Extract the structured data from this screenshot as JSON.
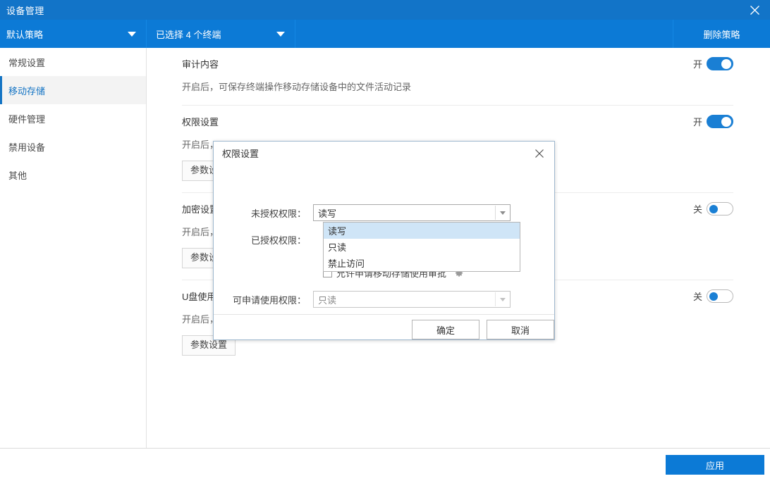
{
  "window": {
    "title": "设备管理",
    "close_icon": "close-icon"
  },
  "toolbar": {
    "policy_select": "默认策略",
    "terminal_select": "已选择 4 个终端",
    "delete_policy": "删除策略"
  },
  "sidebar": {
    "items": [
      {
        "label": "常规设置",
        "selected": false
      },
      {
        "label": "移动存储",
        "selected": true
      },
      {
        "label": "硬件管理",
        "selected": false
      },
      {
        "label": "禁用设备",
        "selected": false
      },
      {
        "label": "其他",
        "selected": false
      }
    ]
  },
  "content": {
    "sections": [
      {
        "title": "审计内容",
        "desc": "开启后，可保存终端操作移动存储设备中的文件活动记录",
        "toggle_label": "开",
        "toggle_state": "on",
        "has_param_button": false,
        "param_button": ""
      },
      {
        "title": "权限设置",
        "desc": "开启后，",
        "toggle_label": "开",
        "toggle_state": "on",
        "has_param_button": true,
        "param_button": "参数设置"
      },
      {
        "title": "加密设置",
        "desc": "开启后，",
        "toggle_label": "关",
        "toggle_state": "off",
        "has_param_button": true,
        "param_button": "参数设置"
      },
      {
        "title": "U盘使用",
        "desc": "开启后，",
        "toggle_label": "关",
        "toggle_state": "off",
        "has_param_button": true,
        "param_button": "参数设置"
      }
    ]
  },
  "footer": {
    "apply": "应用"
  },
  "dialog": {
    "title": "权限设置",
    "close_icon": "close-icon",
    "unauthorized_label": "未授权权限：",
    "unauthorized_value": "读写",
    "authorized_label": "已授权权限：",
    "dropdown_options": [
      {
        "label": "读写",
        "active": true
      },
      {
        "label": "只读",
        "active": false
      },
      {
        "label": "禁止访问",
        "active": false
      }
    ],
    "checkbox_label": "允许申请移动存储使用审批",
    "checkbox_checked": false,
    "gear_icon": "gear-icon",
    "apply_permission_label": "可申请使用权限：",
    "apply_permission_value": "只读",
    "ok": "确定",
    "cancel": "取消"
  },
  "colors": {
    "title_blue": "#1274c8",
    "toolbar_blue": "#0c7ad6",
    "accent": "#1a7fd4",
    "highlight": "#cfe5f7"
  }
}
